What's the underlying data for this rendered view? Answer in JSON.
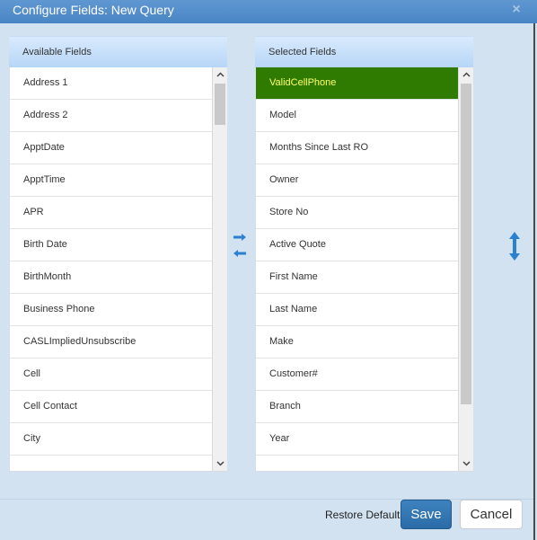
{
  "dialog": {
    "title": "Configure Fields: New Query",
    "close_glyph": "×"
  },
  "available": {
    "header": "Available Fields",
    "items": [
      "Address 1",
      "Address 2",
      "ApptDate",
      "ApptTime",
      "APR",
      "Birth Date",
      "BirthMonth",
      "Business Phone",
      "CASLImpliedUnsubscribe",
      "Cell",
      "Cell Contact",
      "City"
    ]
  },
  "selected": {
    "header": "Selected Fields",
    "items": [
      "ValidCellPhone",
      "Model",
      "Months Since Last RO",
      "Owner",
      "Store No",
      "Active Quote",
      "First Name",
      "Last Name",
      "Make",
      "Customer#",
      "Branch",
      "Year"
    ],
    "active_item": "ValidCellPhone"
  },
  "footer": {
    "restore_defaults": "Restore Defaults",
    "save": "Save",
    "cancel": "Cancel"
  },
  "icons": {
    "move": "swap-arrows-icon",
    "reorder": "up-down-arrow-icon",
    "scroll_up": "chevron-up-icon",
    "scroll_down": "chevron-down-icon"
  },
  "colors": {
    "title_bar": "#4a86c5",
    "dialog_bg": "#d2e2f1",
    "active_row_bg": "#2f7a00",
    "active_row_text": "#ffff6a",
    "save_button": "#2f73b4",
    "icon_blue": "#2b80d0"
  }
}
